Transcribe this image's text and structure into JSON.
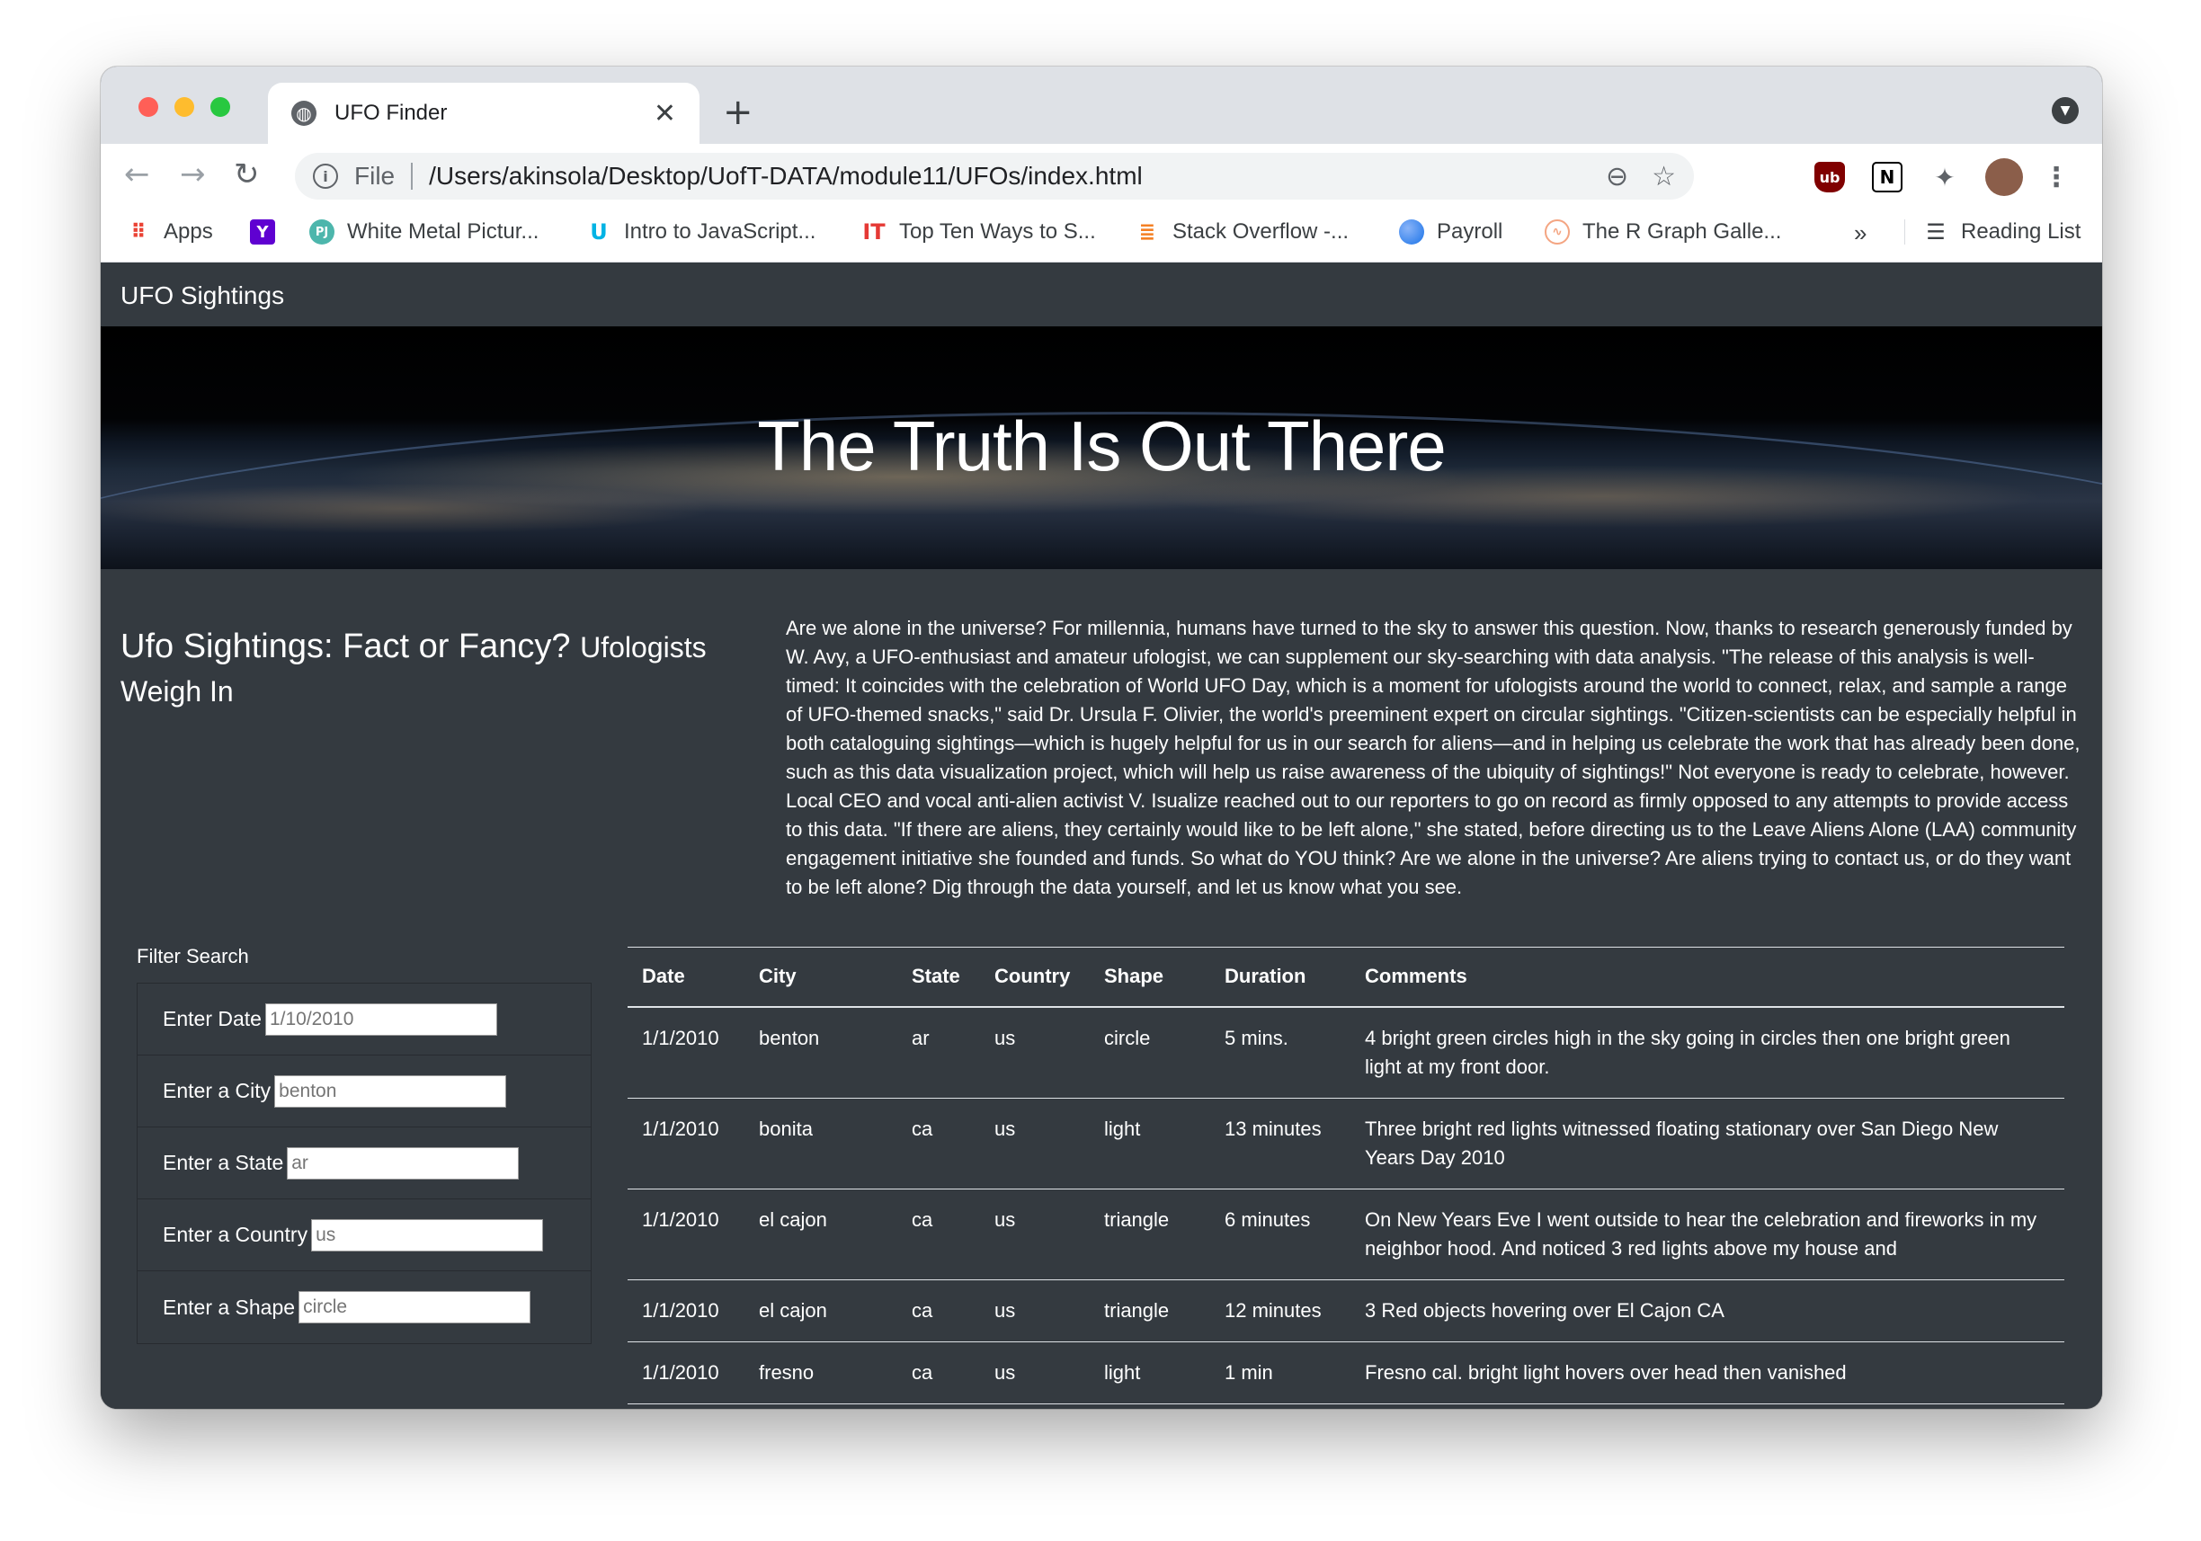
{
  "browser": {
    "tab_title": "UFO Finder",
    "close_glyph": "✕",
    "new_tab_glyph": "+",
    "url_scheme": "File",
    "url": "/Users/akinsola/Desktop/UofT-DATA/module11/UFOs/index.html",
    "bookmarks": [
      {
        "label": "Apps",
        "icon": "apps-grid-icon"
      },
      {
        "label": "",
        "icon": "yahoo-icon"
      },
      {
        "label": "White Metal Pictur...",
        "icon": "pj-icon"
      },
      {
        "label": "Intro to JavaScript...",
        "icon": "udacity-icon"
      },
      {
        "label": "Top Ten Ways to S...",
        "icon": "it-icon"
      },
      {
        "label": "Stack Overflow -...",
        "icon": "stackoverflow-icon"
      },
      {
        "label": "Payroll",
        "icon": "payroll-icon"
      },
      {
        "label": "The R Graph Galle...",
        "icon": "rgraph-icon"
      }
    ],
    "overflow": "»",
    "reading_list": "Reading List"
  },
  "navbar": {
    "brand": "UFO Sightings"
  },
  "hero": {
    "title": "The Truth Is Out There"
  },
  "article": {
    "title": "Ufo Sightings: Fact or Fancy?",
    "subtitle": "Ufologists Weigh In",
    "body": "Are we alone in the universe? For millennia, humans have turned to the sky to answer this question. Now, thanks to research generously funded by W. Avy, a UFO-enthusiast and amateur ufologist, we can supplement our sky-searching with data analysis. \"The release of this analysis is well-timed: It coincides with the celebration of World UFO Day, which is a moment for ufologists around the world to connect, relax, and sample a range of UFO-themed snacks,\" said Dr. Ursula F. Olivier, the world's preeminent expert on circular sightings. \"Citizen-scientists can be especially helpful in both cataloguing sightings—which is hugely helpful for us in our search for aliens—and in helping us celebrate the work that has already been done, such as this data visualization project, which will help us raise awareness of the ubiquity of sightings!\" Not everyone is ready to celebrate, however. Local CEO and vocal anti-alien activist V. Isualize reached out to our reporters to go on record as firmly opposed to any attempts to provide access to this data. \"If there are aliens, they certainly would like to be left alone,\" she stated, before directing us to the Leave Aliens Alone (LAA) community engagement initiative she founded and funds. So what do YOU think? Are we alone in the universe? Are aliens trying to contact us, or do they want to be left alone? Dig through the data yourself, and let us know what you see."
  },
  "filters": {
    "heading": "Filter Search",
    "date": {
      "label": "Enter Date",
      "placeholder": "1/10/2010"
    },
    "city": {
      "label": "Enter a City",
      "placeholder": "benton"
    },
    "state": {
      "label": "Enter a State",
      "placeholder": "ar"
    },
    "country": {
      "label": "Enter a Country",
      "placeholder": "us"
    },
    "shape": {
      "label": "Enter a Shape",
      "placeholder": "circle"
    }
  },
  "table": {
    "headers": [
      "Date",
      "City",
      "State",
      "Country",
      "Shape",
      "Duration",
      "Comments"
    ],
    "rows": [
      [
        "1/1/2010",
        "benton",
        "ar",
        "us",
        "circle",
        "5 mins.",
        "4 bright green circles high in the sky going in circles then one bright green light at my front door."
      ],
      [
        "1/1/2010",
        "bonita",
        "ca",
        "us",
        "light",
        "13 minutes",
        "Three bright red lights witnessed floating stationary over San Diego New Years Day 2010"
      ],
      [
        "1/1/2010",
        "el cajon",
        "ca",
        "us",
        "triangle",
        "6 minutes",
        "On New Years Eve I went outside to hear the celebration and fireworks in my neighbor hood. And noticed 3 red lights above my house and"
      ],
      [
        "1/1/2010",
        "el cajon",
        "ca",
        "us",
        "triangle",
        "12 minutes",
        "3 Red objects hovering over El Cajon CA"
      ],
      [
        "1/1/2010",
        "fresno",
        "ca",
        "us",
        "light",
        "1 min",
        "Fresno cal. bright light hovers over head then vanished"
      ]
    ]
  },
  "colors": {
    "page_bg": "#343a40",
    "traffic_red": "#ff5f57",
    "traffic_yellow": "#febc2e",
    "traffic_green": "#28c840"
  }
}
